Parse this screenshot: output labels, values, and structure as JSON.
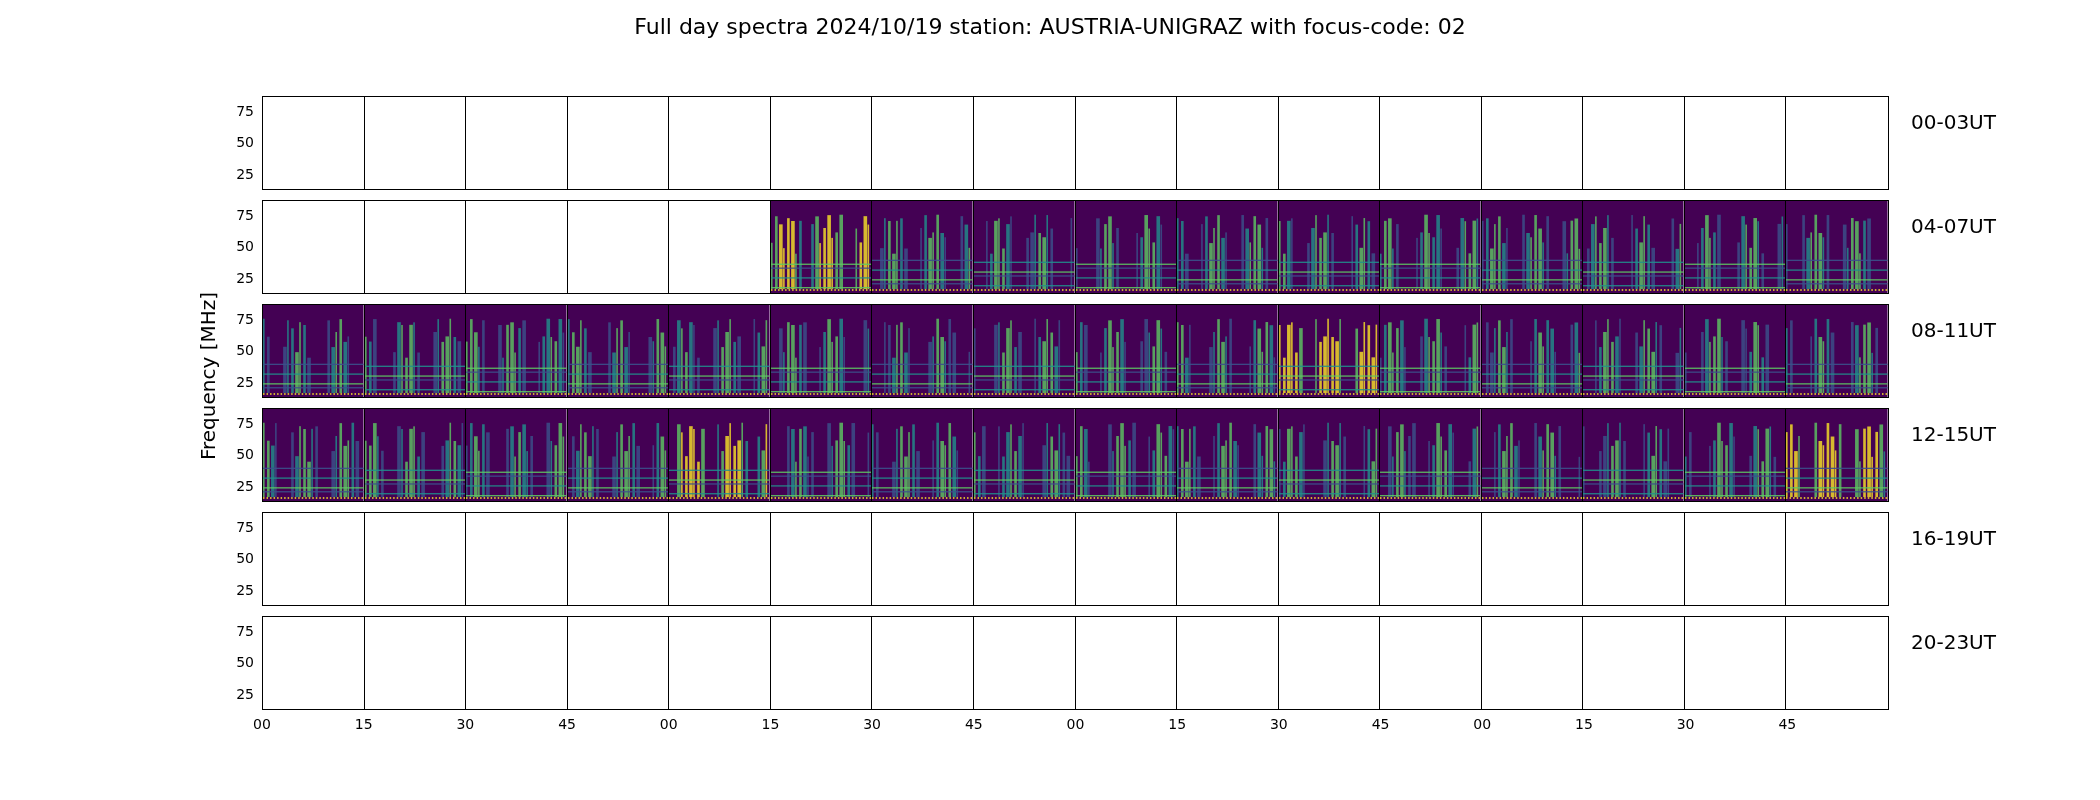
{
  "title": "Full day spectra 2024/10/19 station: AUSTRIA-UNIGRAZ with focus-code: 02",
  "ylabel": "Frequency [MHz]",
  "xticks": [
    "00",
    "15",
    "30",
    "45",
    "00",
    "15",
    "30",
    "45",
    "00",
    "15",
    "30",
    "45",
    "00",
    "15",
    "30",
    "45"
  ],
  "rows": [
    {
      "label": "00-03UT",
      "yticks": [
        "75",
        "50",
        "25"
      ],
      "panels": [
        {
          "kind": "empty"
        },
        {
          "kind": "empty"
        },
        {
          "kind": "empty"
        },
        {
          "kind": "empty"
        },
        {
          "kind": "empty"
        },
        {
          "kind": "empty"
        },
        {
          "kind": "empty"
        },
        {
          "kind": "empty"
        },
        {
          "kind": "empty"
        },
        {
          "kind": "empty"
        },
        {
          "kind": "empty"
        },
        {
          "kind": "empty"
        },
        {
          "kind": "empty"
        },
        {
          "kind": "empty"
        },
        {
          "kind": "empty"
        },
        {
          "kind": "empty"
        }
      ]
    },
    {
      "label": "04-07UT",
      "yticks": [
        "75",
        "50",
        "25"
      ],
      "panels": [
        {
          "kind": "empty"
        },
        {
          "kind": "empty"
        },
        {
          "kind": "empty"
        },
        {
          "kind": "empty"
        },
        {
          "kind": "empty"
        },
        {
          "kind": "spectrum"
        },
        {
          "kind": "spectrum"
        },
        {
          "kind": "spectrum"
        },
        {
          "kind": "spectrum"
        },
        {
          "kind": "spectrum"
        },
        {
          "kind": "spectrum"
        },
        {
          "kind": "spectrum"
        },
        {
          "kind": "spectrum"
        },
        {
          "kind": "spectrum"
        },
        {
          "kind": "spectrum"
        },
        {
          "kind": "spectrum"
        }
      ]
    },
    {
      "label": "08-11UT",
      "yticks": [
        "75",
        "50",
        "25"
      ],
      "panels": [
        {
          "kind": "spectrum"
        },
        {
          "kind": "spectrum"
        },
        {
          "kind": "spectrum"
        },
        {
          "kind": "spectrum"
        },
        {
          "kind": "spectrum"
        },
        {
          "kind": "spectrum"
        },
        {
          "kind": "spectrum"
        },
        {
          "kind": "spectrum"
        },
        {
          "kind": "spectrum"
        },
        {
          "kind": "spectrum"
        },
        {
          "kind": "spectrum"
        },
        {
          "kind": "spectrum"
        },
        {
          "kind": "spectrum"
        },
        {
          "kind": "spectrum"
        },
        {
          "kind": "spectrum"
        },
        {
          "kind": "spectrum"
        }
      ]
    },
    {
      "label": "12-15UT",
      "yticks": [
        "75",
        "50",
        "25"
      ],
      "panels": [
        {
          "kind": "spectrum"
        },
        {
          "kind": "spectrum"
        },
        {
          "kind": "spectrum"
        },
        {
          "kind": "spectrum"
        },
        {
          "kind": "spectrum"
        },
        {
          "kind": "spectrum"
        },
        {
          "kind": "spectrum"
        },
        {
          "kind": "spectrum"
        },
        {
          "kind": "spectrum"
        },
        {
          "kind": "spectrum"
        },
        {
          "kind": "spectrum"
        },
        {
          "kind": "spectrum"
        },
        {
          "kind": "spectrum"
        },
        {
          "kind": "spectrum"
        },
        {
          "kind": "spectrum"
        },
        {
          "kind": "spectrum"
        }
      ]
    },
    {
      "label": "16-19UT",
      "yticks": [
        "75",
        "50",
        "25"
      ],
      "panels": [
        {
          "kind": "empty"
        },
        {
          "kind": "empty"
        },
        {
          "kind": "empty"
        },
        {
          "kind": "empty"
        },
        {
          "kind": "empty"
        },
        {
          "kind": "empty"
        },
        {
          "kind": "empty"
        },
        {
          "kind": "empty"
        },
        {
          "kind": "empty"
        },
        {
          "kind": "empty"
        },
        {
          "kind": "empty"
        },
        {
          "kind": "empty"
        },
        {
          "kind": "empty"
        },
        {
          "kind": "empty"
        },
        {
          "kind": "empty"
        },
        {
          "kind": "empty"
        }
      ]
    },
    {
      "label": "20-23UT",
      "yticks": [
        "75",
        "50",
        "25"
      ],
      "panels": [
        {
          "kind": "empty"
        },
        {
          "kind": "empty"
        },
        {
          "kind": "empty"
        },
        {
          "kind": "empty"
        },
        {
          "kind": "empty"
        },
        {
          "kind": "empty"
        },
        {
          "kind": "empty"
        },
        {
          "kind": "empty"
        },
        {
          "kind": "empty"
        },
        {
          "kind": "empty"
        },
        {
          "kind": "empty"
        },
        {
          "kind": "empty"
        },
        {
          "kind": "empty"
        },
        {
          "kind": "empty"
        },
        {
          "kind": "empty"
        },
        {
          "kind": "empty"
        }
      ]
    }
  ]
}
